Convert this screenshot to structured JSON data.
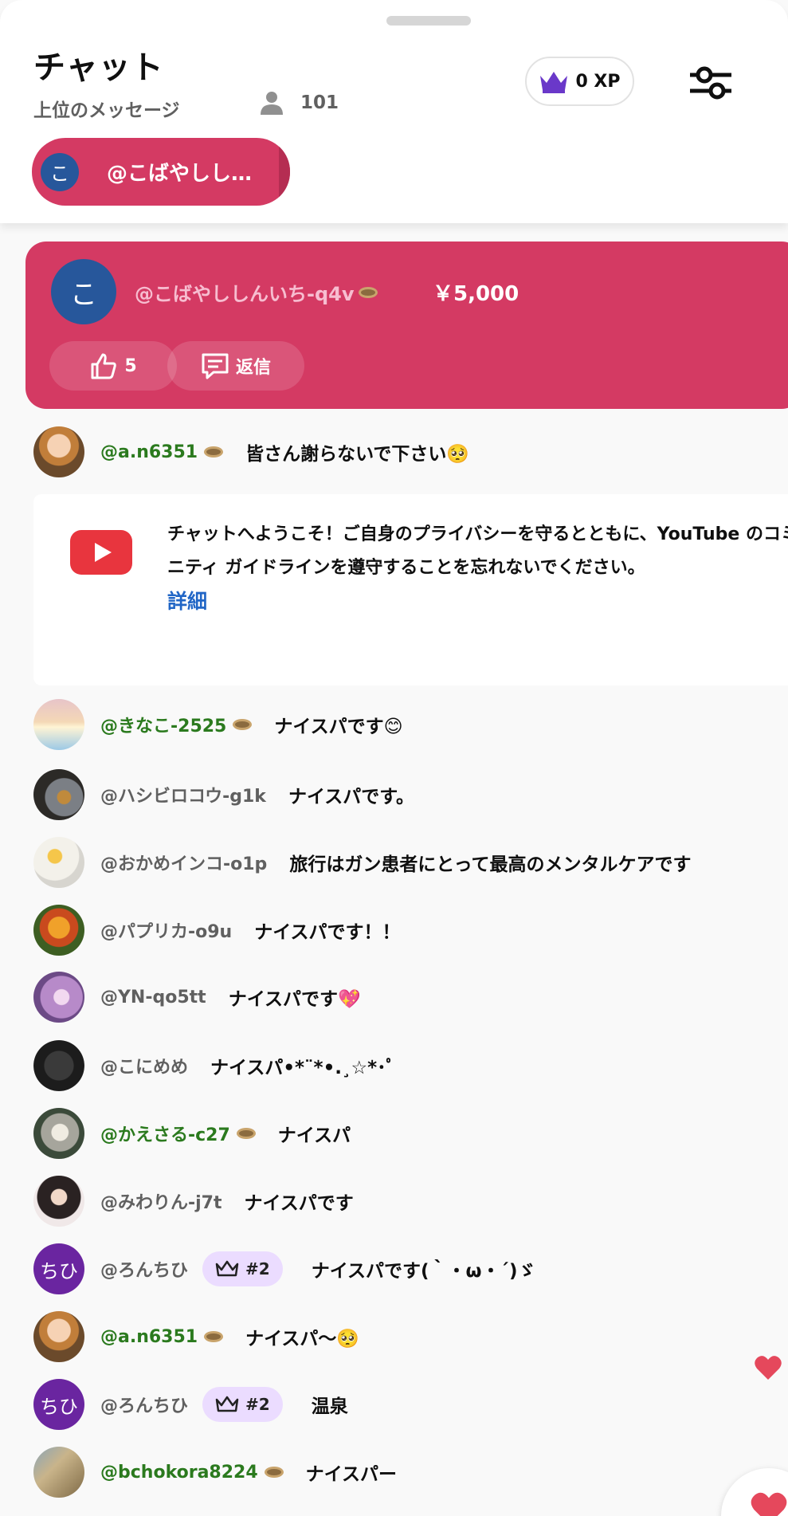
{
  "header": {
    "title": "チャット",
    "subtitle": "上位のメッセージ",
    "viewer_count": "101",
    "xp_label": "0 XP"
  },
  "pinned": {
    "avatar_letter": "こ",
    "name": "@こばやしし…"
  },
  "superchat": {
    "avatar_letter": "こ",
    "name": "@こばやししんいち-q4v",
    "amount": "￥5,000",
    "likes": "5",
    "reply_label": "返信"
  },
  "welcome": {
    "text": "チャットへようこそ！ご自身のプライバシーを守るとともに、YouTube のコミュニティ ガイドラインを遵守することを忘れないでください。",
    "link": "詳細"
  },
  "messages": [
    {
      "name": "@a.n6351",
      "text": "皆さん謝らないで下さい🥺",
      "member": true
    },
    {
      "name": "@きなこ-2525",
      "text": "ナイスパです😊",
      "member": true
    },
    {
      "name": "@ハシビロコウ-g1k",
      "text": "ナイスパです。",
      "member": false
    },
    {
      "name": "@おかめインコ-o1p",
      "text": "旅行はガン患者にとって最高のメンタルケアです",
      "member": false
    },
    {
      "name": "@パプリカ-o9u",
      "text": "ナイスパです！！",
      "member": false
    },
    {
      "name": "@YN-qo5tt",
      "text": "ナイスパです💖",
      "member": false
    },
    {
      "name": "@こにめめ",
      "text": "ナイスパ•*¨*•.¸☆*･ﾟ",
      "member": false
    },
    {
      "name": "@かえさる-c27",
      "text": "ナイスパ",
      "member": true
    },
    {
      "name": "@みわりん-j7t",
      "text": "ナイスパです",
      "member": false
    },
    {
      "name": "@ろんちひ",
      "text": "ナイスパです(｀・ω・´)ゞ",
      "member": false,
      "rank": "#2",
      "avatar_letter": "ちひ"
    },
    {
      "name": "@a.n6351",
      "text": "ナイスパ〜🥺",
      "member": true
    },
    {
      "name": "@ろんちひ",
      "text": "温泉",
      "member": false,
      "rank": "#2",
      "avatar_letter": "ちひ"
    },
    {
      "name": "@bchokora8224",
      "text": "ナイスパー",
      "member": true
    }
  ],
  "colors": {
    "superchat": "#d43a63",
    "member_name": "#2b7a1e",
    "link": "#2166c6",
    "rank_badge": "#ebdcff"
  }
}
